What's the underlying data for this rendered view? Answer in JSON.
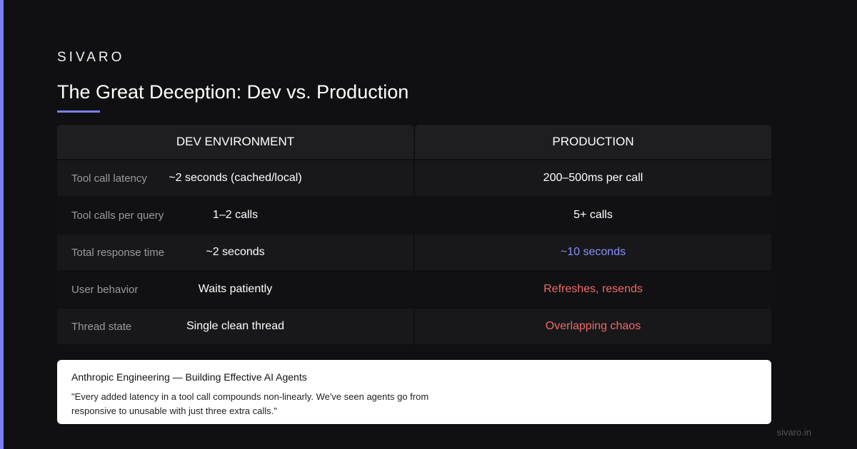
{
  "brand": "SIVARO",
  "title": "The Great Deception: Dev vs. Production",
  "colors": {
    "accent": "#7c7ff0",
    "warning": "#f06a6a",
    "background": "#101012"
  },
  "table": {
    "headers": [
      "DEV ENVIRONMENT",
      "PRODUCTION"
    ],
    "rows": [
      {
        "label": "Tool call latency",
        "dev": "~2 seconds (cached/local)",
        "prod": "200–500ms per call"
      },
      {
        "label": "Tool calls per query",
        "dev": "1–2 calls",
        "prod": "5+ calls"
      },
      {
        "label": "Total response time",
        "dev": "~2 seconds",
        "prod": "~10 seconds"
      },
      {
        "label": "User behavior",
        "dev": "Waits patiently",
        "prod": "Refreshes, resends"
      },
      {
        "label": "Thread state",
        "dev": "Single clean thread",
        "prod": "Overlapping chaos"
      }
    ]
  },
  "quote": {
    "source": "Anthropic Engineering — Building Effective AI Agents",
    "text": "\"Every added latency in a tool call compounds non-linearly. We've seen agents go from responsive to unusable with just three extra calls.\""
  },
  "footer": "sivaro.in"
}
